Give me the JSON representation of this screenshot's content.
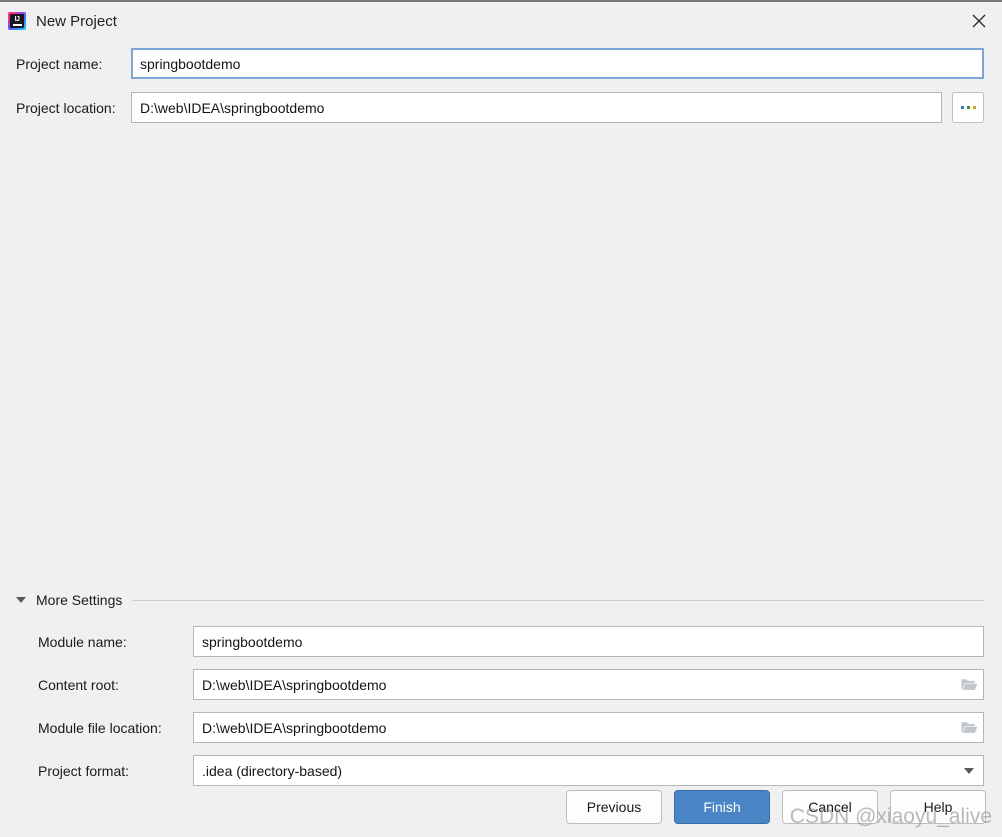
{
  "window": {
    "title": "New Project",
    "app_icon": "intellij-idea-icon",
    "close_icon": "close-icon"
  },
  "top_form": {
    "rows": [
      {
        "label": "Project name:",
        "value": "springbootdemo",
        "placeholder": "",
        "focused": true,
        "has_browse": false
      },
      {
        "label": "Project location:",
        "value": "D:\\web\\IDEA\\springbootdemo",
        "placeholder": "",
        "focused": false,
        "has_browse": true,
        "browse_label": "..."
      }
    ]
  },
  "more_settings": {
    "label": "More Settings",
    "expanded": true,
    "toggle_icon": "chevron-down-icon",
    "rows": [
      {
        "label": "Module name:",
        "value": "springbootdemo",
        "trailing_icon": "none"
      },
      {
        "label": "Content root:",
        "value": "D:\\web\\IDEA\\springbootdemo",
        "trailing_icon": "folder-icon"
      },
      {
        "label": "Module file location:",
        "value": "D:\\web\\IDEA\\springbootdemo",
        "trailing_icon": "folder-icon"
      },
      {
        "label": "Project format:",
        "value": ".idea (directory-based)",
        "trailing_icon": "chevron-down-icon"
      }
    ]
  },
  "footer": {
    "previous_label": "Previous",
    "finish_label": "Finish",
    "cancel_label": "Cancel",
    "help_label": "Help"
  },
  "watermark": {
    "text": "CSDN @xiaoyu_alive"
  },
  "colors": {
    "background": "#f0f0f0",
    "focus_border": "#7ba7d7",
    "primary_button": "#4a86c5",
    "field_border": "#b6b6b6",
    "divider": "#cdcdcd"
  }
}
